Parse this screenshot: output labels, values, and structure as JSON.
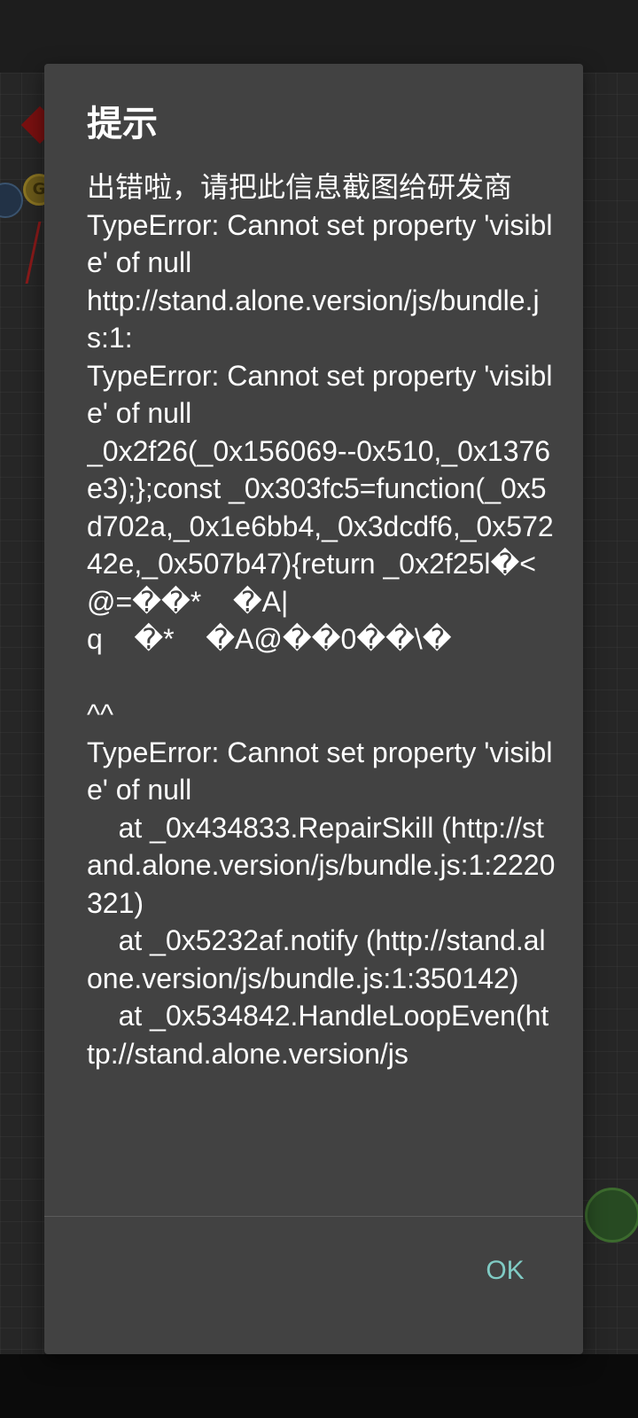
{
  "dialog": {
    "title": "提示",
    "message": "出错啦，请把此信息截图给研发商\nTypeError: Cannot set property 'visible' of null\nhttp://stand.alone.version/js/bundle.js:1:\nTypeError: Cannot set property 'visible' of null\n_0x2f26(_0x156069--0x510,_0x1376e3);};const _0x303fc5=function(_0x5d702a,_0x1e6bb4,_0x3dcdf6,_0x57242e,_0x507b47){return _0x2f25l�<@=��*    �A|\nq    �*    �A@��0��\\�\n\n^^\nTypeError: Cannot set property 'visible' of null\n    at _0x434833.RepairSkill (http://stand.alone.version/js/bundle.js:1:2220321)\n    at _0x5232af.notify (http://stand.alone.version/js/bundle.js:1:350142)\n    at _0x534842.HandleLoopEven(http://stand.alone.version/js",
    "ok_label": "OK"
  },
  "background": {
    "coin_letter": "G"
  },
  "colors": {
    "dialog_bg": "#424242",
    "accent": "#80cbc4",
    "text": "#ffffff"
  }
}
